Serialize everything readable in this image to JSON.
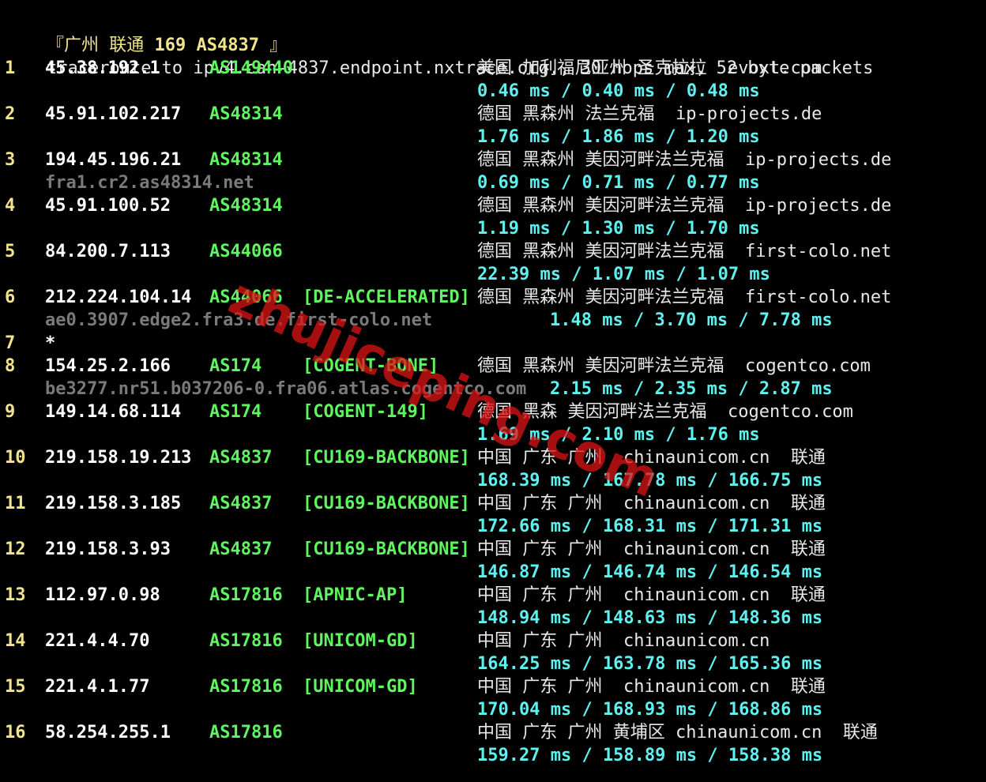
{
  "header": {
    "bracket_open": "『",
    "city": "广州",
    "isp": "联通",
    "route": "169 AS4837",
    "bracket_close": "』"
  },
  "command_line": "traceroute to ipv4.can-4837.endpoint.nxtrace.org., 30 hops max, 52 byte packets",
  "hops": [
    {
      "hop": "1",
      "ip": "45.38.192.1",
      "asn": "AS149440",
      "tag": "",
      "location": "美国 加利福尼亚州 圣克拉拉  evoxt.com",
      "hostname": "",
      "rtt": "0.46 ms / 0.40 ms / 0.48 ms"
    },
    {
      "hop": "2",
      "ip": "45.91.102.217",
      "asn": "AS48314",
      "tag": "",
      "location": "德国 黑森州 法兰克福  ip-projects.de",
      "hostname": "",
      "rtt": "1.76 ms / 1.86 ms / 1.20 ms"
    },
    {
      "hop": "3",
      "ip": "194.45.196.21",
      "asn": "AS48314",
      "tag": "",
      "location": "德国 黑森州 美因河畔法兰克福  ip-projects.de",
      "hostname": "fra1.cr2.as48314.net",
      "rtt": "0.69 ms / 0.71 ms / 0.77 ms"
    },
    {
      "hop": "4",
      "ip": "45.91.100.52",
      "asn": "AS48314",
      "tag": "",
      "location": "德国 黑森州 美因河畔法兰克福  ip-projects.de",
      "hostname": "",
      "rtt": "1.19 ms / 1.30 ms / 1.70 ms"
    },
    {
      "hop": "5",
      "ip": "84.200.7.113",
      "asn": "AS44066",
      "tag": "",
      "location": "德国 黑森州 美因河畔法兰克福  first-colo.net",
      "hostname": "",
      "rtt": "22.39 ms / 1.07 ms / 1.07 ms"
    },
    {
      "hop": "6",
      "ip": "212.224.104.14",
      "asn": "AS44066",
      "tag": "[DE-ACCELERATED]",
      "location": "德国 黑森州 美因河畔法兰克福  first-colo.net",
      "hostname": "ae0.3907.edge2.fra3.de.first-colo.net",
      "rtt": "1.48 ms / 3.70 ms / 7.78 ms"
    },
    {
      "hop": "7",
      "ip": "*",
      "asn": "",
      "tag": "",
      "location": "",
      "hostname": "",
      "rtt": ""
    },
    {
      "hop": "8",
      "ip": "154.25.2.166",
      "asn": "AS174",
      "tag": "[COGENT-BONE]",
      "location": "德国 黑森州 美因河畔法兰克福  cogentco.com",
      "hostname": "be3277.nr51.b037206-0.fra06.atlas.cogentco.com",
      "rtt": "2.15 ms / 2.35 ms / 2.87 ms"
    },
    {
      "hop": "9",
      "ip": "149.14.68.114",
      "asn": "AS174",
      "tag": "[COGENT-149]",
      "location": "德国 黑森 美因河畔法兰克福  cogentco.com",
      "hostname": "",
      "rtt": "1.69 ms / 2.10 ms / 1.76 ms"
    },
    {
      "hop": "10",
      "ip": "219.158.19.213",
      "asn": "AS4837",
      "tag": "[CU169-BACKBONE]",
      "location": "中国 广东 广州  chinaunicom.cn  联通",
      "hostname": "",
      "rtt": "168.39 ms / 167.78 ms / 166.75 ms"
    },
    {
      "hop": "11",
      "ip": "219.158.3.185",
      "asn": "AS4837",
      "tag": "[CU169-BACKBONE]",
      "location": "中国 广东 广州  chinaunicom.cn  联通",
      "hostname": "",
      "rtt": "172.66 ms / 168.31 ms / 171.31 ms"
    },
    {
      "hop": "12",
      "ip": "219.158.3.93",
      "asn": "AS4837",
      "tag": "[CU169-BACKBONE]",
      "location": "中国 广东 广州  chinaunicom.cn  联通",
      "hostname": "",
      "rtt": "146.87 ms / 146.74 ms / 146.54 ms"
    },
    {
      "hop": "13",
      "ip": "112.97.0.98",
      "asn": "AS17816",
      "tag": "[APNIC-AP]",
      "location": "中国 广东 广州  chinaunicom.cn  联通",
      "hostname": "",
      "rtt": "148.94 ms / 148.63 ms / 148.36 ms"
    },
    {
      "hop": "14",
      "ip": "221.4.4.70",
      "asn": "AS17816",
      "tag": "[UNICOM-GD]",
      "location": "中国 广东 广州  chinaunicom.cn",
      "hostname": "",
      "rtt": "164.25 ms / 163.78 ms / 165.36 ms"
    },
    {
      "hop": "15",
      "ip": "221.4.1.77",
      "asn": "AS17816",
      "tag": "[UNICOM-GD]",
      "location": "中国 广东 广州  chinaunicom.cn  联通",
      "hostname": "",
      "rtt": "170.04 ms / 168.93 ms / 168.86 ms"
    },
    {
      "hop": "16",
      "ip": "58.254.255.1",
      "asn": "AS17816",
      "tag": "",
      "location": "中国 广东 广州 黄埔区 chinaunicom.cn  联通",
      "hostname": "",
      "rtt": "159.27 ms / 158.89 ms / 158.38 ms"
    }
  ],
  "watermark": "zhujiceping.com",
  "colors": {
    "hop_number": "#f2e48a",
    "ip": "#ffffff",
    "asn": "#5ff55f",
    "rtt": "#5ff0f0",
    "hostname": "#7a7a7a",
    "watermark": "#dc1414"
  }
}
